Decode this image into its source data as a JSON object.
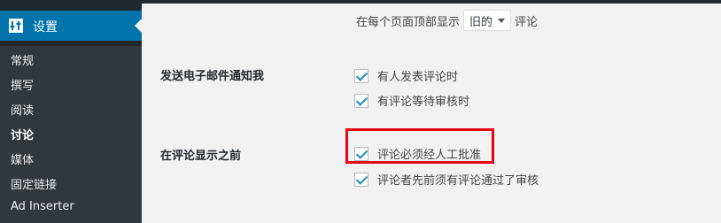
{
  "sidebar": {
    "header_label": "设置",
    "items": [
      {
        "label": "常规"
      },
      {
        "label": "撰写"
      },
      {
        "label": "阅读"
      },
      {
        "label": "讨论"
      },
      {
        "label": "媒体"
      },
      {
        "label": "固定链接"
      },
      {
        "label": "Ad Inserter"
      }
    ]
  },
  "settings": {
    "comment_order": {
      "prefix": "在每个页面顶部显示",
      "select_value": "旧的",
      "suffix": "评论"
    },
    "email_me": {
      "label": "发送电子邮件通知我",
      "options": [
        "有人发表评论时",
        "有评论等待审核时"
      ]
    },
    "before_appears": {
      "label": "在评论显示之前",
      "options": [
        "评论必须经人工批准",
        "评论者先前须有评论通过了审核"
      ]
    }
  },
  "colors": {
    "sidebar_bg": "#23282d",
    "submenu_bg": "#32373c",
    "accent": "#0073aa",
    "highlight_box": "#e30613",
    "checkmark": "#1e8cbe"
  },
  "icons": [
    "settings-icon",
    "checkbox-checked-icon",
    "caret-down-icon"
  ]
}
